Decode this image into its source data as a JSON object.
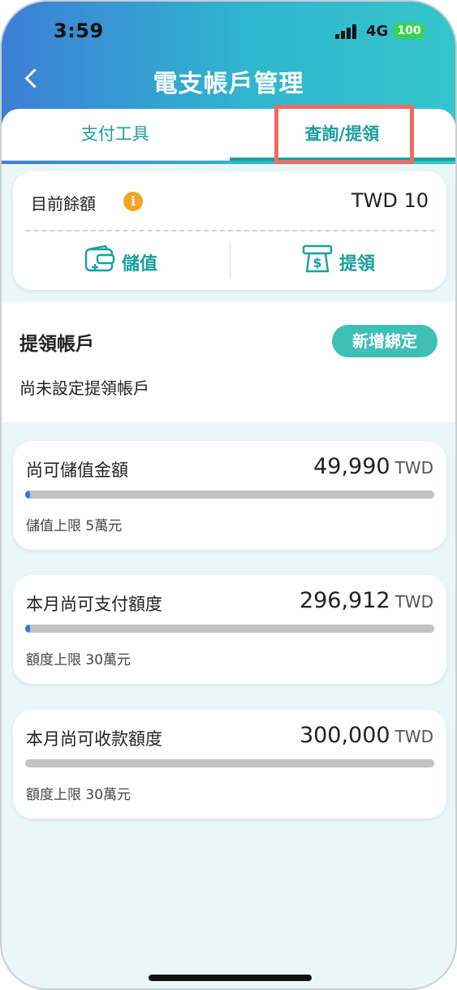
{
  "status_bar": {
    "time": "3:59",
    "network": "4G",
    "battery": "100"
  },
  "nav": {
    "title": "電支帳戶管理"
  },
  "tabs": [
    {
      "label": "支付工具"
    },
    {
      "label": "查詢/提領"
    }
  ],
  "balance": {
    "label": "目前餘額",
    "value": "TWD 10",
    "deposit_label": "儲值",
    "withdraw_label": "提領"
  },
  "withdraw_account": {
    "title": "提領帳戶",
    "bind_button": "新增綁定",
    "status": "尚未設定提領帳戶"
  },
  "limits": [
    {
      "label": "尚可儲值金額",
      "value": "49,990",
      "currency": "TWD",
      "note": "儲值上限 5萬元",
      "used_fraction": 0.0002
    },
    {
      "label": "本月尚可支付額度",
      "value": "296,912",
      "currency": "TWD",
      "note": "額度上限 30萬元",
      "used_fraction": 0.0103
    },
    {
      "label": "本月尚可收款額度",
      "value": "300,000",
      "currency": "TWD",
      "note": "額度上限 30萬元",
      "used_fraction": 0.0
    }
  ],
  "colors": {
    "accent": "#16a0a0",
    "highlight": "#ee6b63",
    "progress": "#2b7be0",
    "info": "#f3a623"
  }
}
